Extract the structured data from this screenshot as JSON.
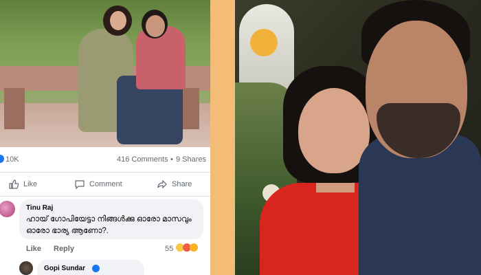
{
  "post": {
    "reactions_count": "10K",
    "comments_count": "416 Comments",
    "shares_separator": "•",
    "shares_count": "9 Shares",
    "actions": {
      "like": "Like",
      "comment": "Comment",
      "share": "Share"
    }
  },
  "comment": {
    "author": "Tinu Raj",
    "text": "ഹായ് ഗോപിയേട്ടാ നിങ്ങൾക്കു ഓരോ മാസവും ഓരോ ഭാര്യ ആണോ?.",
    "like_label": "Like",
    "reply_label": "Reply",
    "reaction_count": "55"
  },
  "reply": {
    "author": "Gopi Sundar"
  },
  "colors": {
    "accent_blue": "#1877f2",
    "divider_orange": "#f3bd78",
    "bubble_bg": "#f0f2f5"
  }
}
